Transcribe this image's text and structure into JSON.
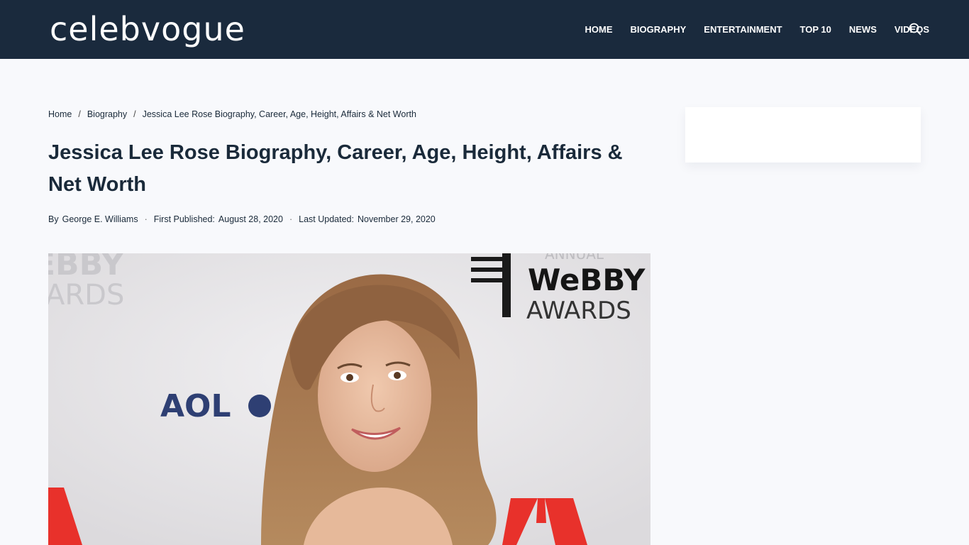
{
  "site": {
    "logo": "celebvogue"
  },
  "nav": {
    "items": [
      {
        "label": "HOME"
      },
      {
        "label": "BIOGRAPHY"
      },
      {
        "label": "ENTERTAINMENT"
      },
      {
        "label": "TOP 10"
      },
      {
        "label": "NEWS"
      },
      {
        "label": "VIDEOS"
      }
    ],
    "search_icon": "search-icon"
  },
  "breadcrumb": {
    "items": [
      {
        "label": "Home"
      },
      {
        "label": "Biography"
      },
      {
        "label": "Jessica Lee Rose Biography, Career, Age, Height, Affairs & Net Worth"
      }
    ],
    "separator": "/"
  },
  "article": {
    "title": "Jessica Lee Rose Biography, Career, Age, Height, Affairs & Net Worth",
    "meta": {
      "by_label": "By",
      "author": "George E. Williams",
      "first_published_label": "First Published:",
      "first_published": "August 28, 2020",
      "last_updated_label": "Last Updated:",
      "last_updated": "November 29, 2020",
      "separator": "·"
    },
    "hero_image": {
      "backdrop_text": {
        "webby_top_left": "EBBY",
        "awards_top_left": "ARDS",
        "annual": "ANNUAL",
        "webby": "WeBBY",
        "awards": "AWARDS",
        "aol": "AOL"
      }
    }
  },
  "colors": {
    "header_bg": "#1a2a3d",
    "page_bg": "#f8f9fc",
    "text": "#1a2a3a",
    "adobe_red": "#e8312b",
    "aol_blue": "#2e3f73"
  }
}
